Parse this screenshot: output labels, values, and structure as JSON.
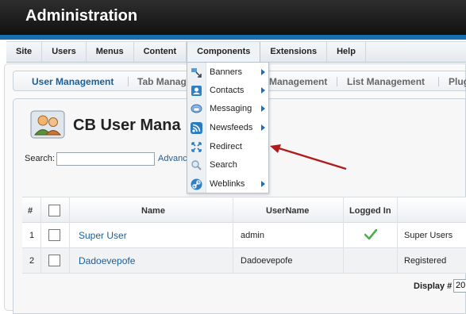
{
  "header": {
    "title": "Administration"
  },
  "menubar": {
    "items": [
      {
        "label": "Site"
      },
      {
        "label": "Users"
      },
      {
        "label": "Menus"
      },
      {
        "label": "Content"
      },
      {
        "label": "Components"
      },
      {
        "label": "Extensions"
      },
      {
        "label": "Help"
      }
    ]
  },
  "dropdown": {
    "items": [
      {
        "label": "Banners",
        "icon": "banners-icon",
        "has_submenu": true
      },
      {
        "label": "Contacts",
        "icon": "contacts-icon",
        "has_submenu": true
      },
      {
        "label": "Messaging",
        "icon": "messaging-icon",
        "has_submenu": true
      },
      {
        "label": "Newsfeeds",
        "icon": "newsfeeds-icon",
        "has_submenu": true
      },
      {
        "label": "Redirect",
        "icon": "redirect-icon",
        "has_submenu": false
      },
      {
        "label": "Search",
        "icon": "search-icon",
        "has_submenu": false
      },
      {
        "label": "Weblinks",
        "icon": "weblinks-icon",
        "has_submenu": true
      }
    ]
  },
  "subtabs": {
    "items": [
      {
        "label": "User Management"
      },
      {
        "label": "Tab Manag"
      },
      {
        "label": "Management"
      },
      {
        "label": "List Management"
      },
      {
        "label": "Plug"
      }
    ]
  },
  "page": {
    "title": "CB User Mana",
    "search_label": "Search:",
    "search_value": "",
    "advanced_link": "Advanc"
  },
  "table": {
    "headers": {
      "num": "#",
      "name": "Name",
      "username": "UserName",
      "logged_in": "Logged In"
    },
    "rows": [
      {
        "num": "1",
        "name": "Super User",
        "username": "admin",
        "logged_in": true,
        "group": "Super Users"
      },
      {
        "num": "2",
        "name": "Dadoevepofe",
        "username": "Dadoevepofe",
        "logged_in": false,
        "group": "Registered"
      }
    ],
    "display_label": "Display #",
    "display_value": "20"
  },
  "colors": {
    "header_bg": "#111111",
    "accent_blue": "#1a6fb1",
    "link_blue": "#1b5e99",
    "annotation_arrow": "#b01c1c",
    "check_green": "#4caf50"
  }
}
